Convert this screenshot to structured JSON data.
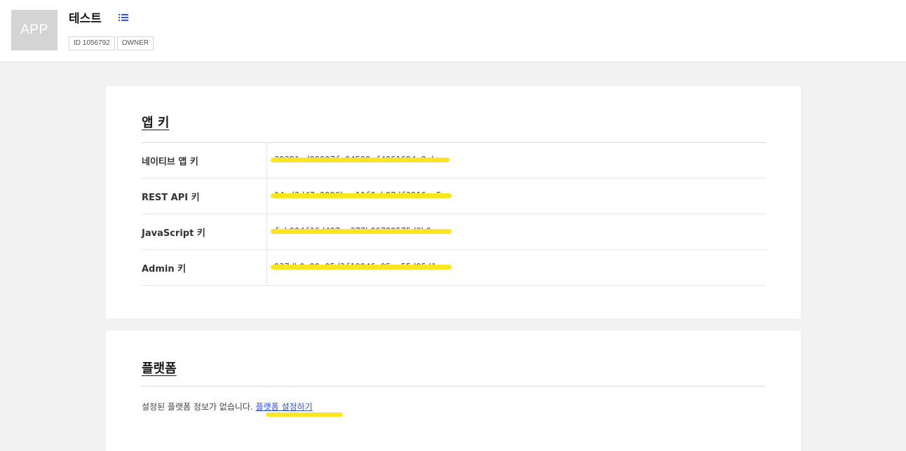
{
  "header": {
    "app_icon_text": "APP",
    "app_name": "테스트",
    "menu_icon": "list-icon",
    "accent_color": "#3b4fd4",
    "badges": [
      "ID 1056792",
      "OWNER"
    ]
  },
  "app_keys": {
    "title": "앱 키",
    "rows": [
      {
        "label": "네이티브 앱 키",
        "value": "39391ed99997fe94599ef4961694e9eb"
      },
      {
        "label": "REST API 키",
        "value": "14ed3d47e9996bee11f0eb97df3916ee5"
      },
      {
        "label": "JavaScript 키",
        "value": "fcb004f16d497ee377b06799575d3b9e"
      },
      {
        "label": "Admin 키",
        "value": "937db0e99e05d3f19946e95ec55d05d1"
      }
    ],
    "redaction_color": "#ffe51f"
  },
  "platform": {
    "title": "플랫폼",
    "message": "설정된 플랫폼 정보가 없습니다. ",
    "link_label": "플랫폼 설정하기",
    "link_color": "#2f52d8"
  }
}
